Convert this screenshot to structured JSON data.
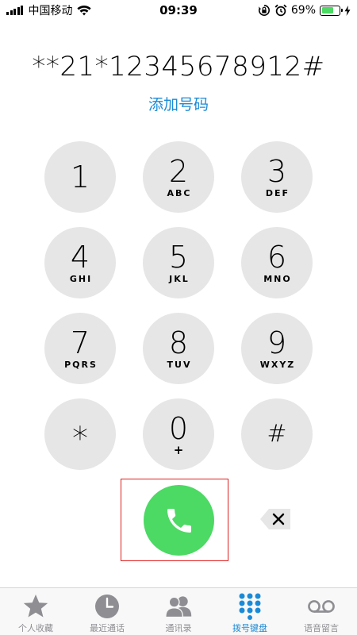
{
  "status_bar": {
    "carrier": "中国移动",
    "time": "09:39",
    "battery_percent": "69%",
    "battery_level": 0.69
  },
  "dialer": {
    "number": "**21*12345678912#",
    "add_number_label": "添加号码"
  },
  "keypad": {
    "keys": [
      {
        "digit": "1",
        "letters": ""
      },
      {
        "digit": "2",
        "letters": "ABC"
      },
      {
        "digit": "3",
        "letters": "DEF"
      },
      {
        "digit": "4",
        "letters": "GHI"
      },
      {
        "digit": "5",
        "letters": "JKL"
      },
      {
        "digit": "6",
        "letters": "MNO"
      },
      {
        "digit": "7",
        "letters": "PQRS"
      },
      {
        "digit": "8",
        "letters": "TUV"
      },
      {
        "digit": "9",
        "letters": "WXYZ"
      },
      {
        "digit": "*",
        "letters": ""
      },
      {
        "digit": "0",
        "letters": "+"
      },
      {
        "digit": "#",
        "letters": ""
      }
    ]
  },
  "icons": {
    "call": "phone-icon",
    "delete": "backspace-icon"
  },
  "colors": {
    "key_background": "#e6e6e6",
    "call_green": "#4cd964",
    "accent_blue": "#1b8ad6",
    "highlight_red": "#e02020",
    "tab_inactive": "#8e8e93"
  },
  "tab_bar": {
    "tabs": [
      {
        "label": "个人收藏",
        "icon": "star-icon",
        "active": false
      },
      {
        "label": "最近通话",
        "icon": "clock-icon",
        "active": false
      },
      {
        "label": "通讯录",
        "icon": "contacts-icon",
        "active": false
      },
      {
        "label": "拨号键盘",
        "icon": "keypad-icon",
        "active": true
      },
      {
        "label": "语音留言",
        "icon": "voicemail-icon",
        "active": false
      }
    ]
  }
}
